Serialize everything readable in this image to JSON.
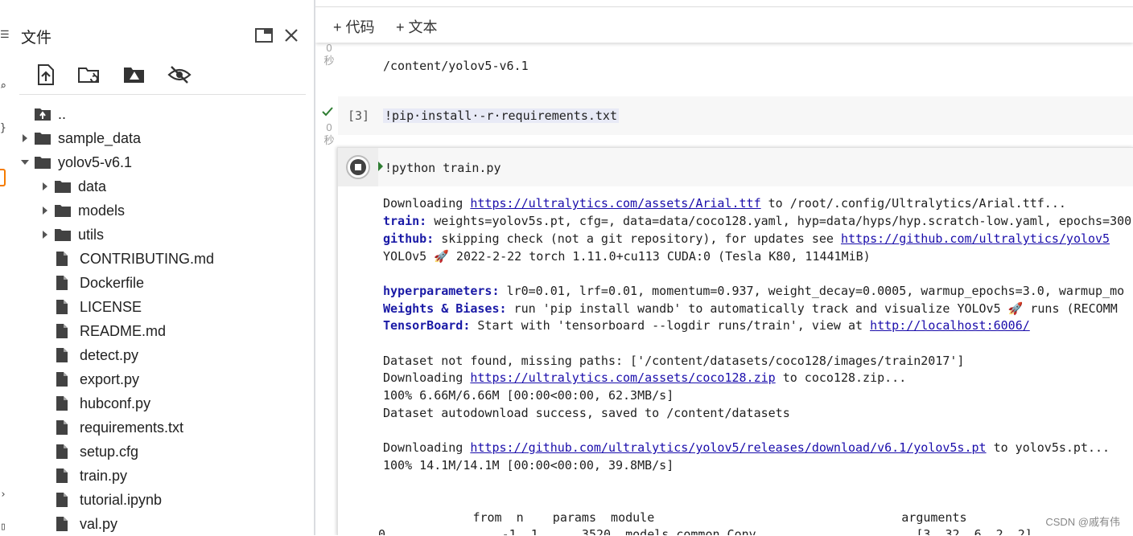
{
  "files_panel": {
    "title": "文件",
    "tree": [
      {
        "label": "..",
        "type": "up",
        "depth": 0
      },
      {
        "label": "sample_data",
        "type": "folder",
        "depth": 0,
        "expanded": false
      },
      {
        "label": "yolov5-v6.1",
        "type": "folder",
        "depth": 0,
        "expanded": true
      },
      {
        "label": "data",
        "type": "folder",
        "depth": 1,
        "expanded": false
      },
      {
        "label": "models",
        "type": "folder",
        "depth": 1,
        "expanded": false
      },
      {
        "label": "utils",
        "type": "folder",
        "depth": 1,
        "expanded": false
      },
      {
        "label": "CONTRIBUTING.md",
        "type": "file",
        "depth": 1
      },
      {
        "label": "Dockerfile",
        "type": "file",
        "depth": 1
      },
      {
        "label": "LICENSE",
        "type": "file",
        "depth": 1
      },
      {
        "label": "README.md",
        "type": "file",
        "depth": 1
      },
      {
        "label": "detect.py",
        "type": "file",
        "depth": 1
      },
      {
        "label": "export.py",
        "type": "file",
        "depth": 1
      },
      {
        "label": "hubconf.py",
        "type": "file",
        "depth": 1
      },
      {
        "label": "requirements.txt",
        "type": "file",
        "depth": 1
      },
      {
        "label": "setup.cfg",
        "type": "file",
        "depth": 1
      },
      {
        "label": "train.py",
        "type": "file",
        "depth": 1
      },
      {
        "label": "tutorial.ipynb",
        "type": "file",
        "depth": 1
      },
      {
        "label": "val.py",
        "type": "file",
        "depth": 1
      }
    ],
    "toolbar_icons": [
      "upload-file-icon",
      "refresh-folder-icon",
      "mount-drive-icon",
      "hide-files-icon"
    ]
  },
  "notebook": {
    "toolbar": {
      "add_code": "+ 代码",
      "add_text": "+ 文本"
    },
    "top_cell": {
      "time_value": "0",
      "time_unit": "秒",
      "output": "/content/yolov5-v6.1"
    },
    "cell3": {
      "prompt": "[3]",
      "code": "!pip·install·-r·requirements.txt",
      "time_value": "0",
      "time_unit": "秒",
      "status": "done"
    },
    "running_cell": {
      "code": "!python  train.py",
      "output": {
        "l1_pre": "Downloading ",
        "l1_link": "https://ultralytics.com/assets/Arial.ttf",
        "l1_post": " to /root/.config/Ultralytics/Arial.ttf...",
        "l2_kw": "train:",
        "l2_rest": " weights=yolov5s.pt, cfg=, data=data/coco128.yaml, hyp=data/hyps/hyp.scratch-low.yaml, epochs=300",
        "l3_kw": "github:",
        "l3_rest": " skipping check (not a git repository), for updates see ",
        "l3_link": "https://github.com/ultralytics/yolov5",
        "l4_a": "YOLOv5 ",
        "l4_b": " 2022-2-22 torch 1.11.0+cu113 CUDA:0 (Tesla K80, 11441MiB)",
        "l5_kw": "hyperparameters:",
        "l5_rest": " lr0=0.01, lrf=0.01, momentum=0.937, weight_decay=0.0005, warmup_epochs=3.0, warmup_mo",
        "l6_kw": "Weights & Biases:",
        "l6_rest": " run 'pip install wandb' to automatically track and visualize YOLOv5 ",
        "l6_post": " runs (RECOMM",
        "l7_kw": "TensorBoard:",
        "l7_rest": " Start with 'tensorboard --logdir runs/train', view at ",
        "l7_link": "http://localhost:6006/",
        "l8": "Dataset not found, missing paths: ['/content/datasets/coco128/images/train2017']",
        "l9_pre": "Downloading ",
        "l9_link": "https://ultralytics.com/assets/coco128.zip",
        "l9_post": " to coco128.zip...",
        "l10": "100% 6.66M/6.66M [00:00<00:00, 62.3MB/s]",
        "l11": "Dataset autodownload success, saved to /content/datasets",
        "l12_pre": "Downloading ",
        "l12_link": "https://github.com/ultralytics/yolov5/releases/download/v6.1/yolov5s.pt",
        "l12_post": " to yolov5s.pt...",
        "l13": "100% 14.1M/14.1M [00:00<00:00, 39.8MB/s]",
        "table_header": "               from  n    params  module                                  arguments",
        "table_row0": "  0                -1  1      3520  models.common.Conv                      [3, 32, 6, 2, 2]"
      }
    }
  },
  "watermark": "CSDN @戚有伟",
  "colors": {
    "accent_orange": "#f57c00",
    "link": "#1a0dab",
    "keyword": "#1a1aa6",
    "check_green": "#2e7d32"
  }
}
